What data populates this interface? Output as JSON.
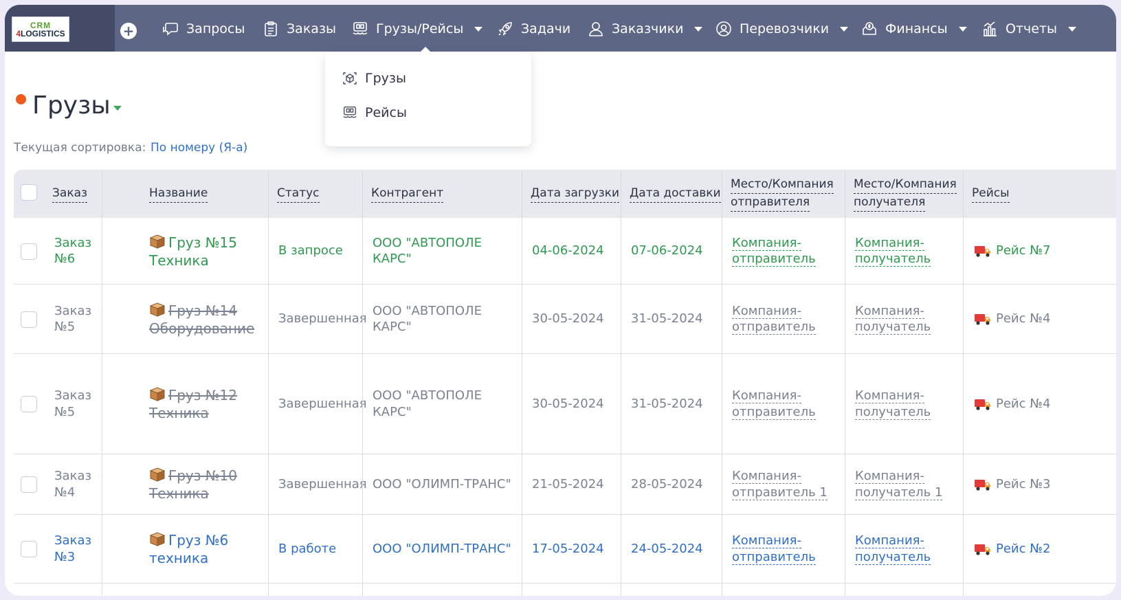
{
  "app": {
    "logo_top": "CRM",
    "logo_bottom_prefix": "4",
    "logo_bottom_rest": "LOGISTICS"
  },
  "nav": {
    "add_symbol": "+",
    "items": [
      {
        "label": "Запросы",
        "icon": "chat-icon",
        "dropdown": false
      },
      {
        "label": "Заказы",
        "icon": "clipboard-icon",
        "dropdown": false
      },
      {
        "label": "Грузы/Рейсы",
        "icon": "cargo-ship-icon",
        "dropdown": true
      },
      {
        "label": "Задачи",
        "icon": "rocket-icon",
        "dropdown": false
      },
      {
        "label": "Заказчики",
        "icon": "user-icon",
        "dropdown": true
      },
      {
        "label": "Перевозчики",
        "icon": "user-circle-icon",
        "dropdown": true
      },
      {
        "label": "Финансы",
        "icon": "money-icon",
        "dropdown": true
      },
      {
        "label": "Отчеты",
        "icon": "chart-icon",
        "dropdown": true
      }
    ]
  },
  "dropdown": {
    "items": [
      {
        "label": "Грузы",
        "icon": "box-scan-icon"
      },
      {
        "label": "Рейсы",
        "icon": "cargo-ship-icon"
      }
    ]
  },
  "page": {
    "title": "Грузы",
    "sort_label": "Текущая сортировка:",
    "sort_value": "По номеру (Я-а)"
  },
  "colors": {
    "nav_bg": "#5d6685",
    "accent_dot": "#f05a1a",
    "active_green": "#2f9a4f",
    "in_work_blue": "#2f6fc5",
    "completed_grey": "#7a8190"
  },
  "table": {
    "headers": {
      "order": "Заказ",
      "name": "Название",
      "status": "Статус",
      "contractor": "Контрагент",
      "load_date": "Дата загрузки",
      "delivery_date": "Дата доставки",
      "sender_l1": "Место/Компания",
      "sender_l2": "отправителя",
      "receiver_l1": "Место/Компания",
      "receiver_l2": "получателя",
      "trips": "Рейсы"
    },
    "rows": [
      {
        "order_l1": "Заказ",
        "order_l2": "№6",
        "name_l1": "Груз №15",
        "name_l2": "Техника",
        "status": "В запросе",
        "contractor_l1": "ООО \"АВТОПОЛЕ",
        "contractor_l2": "КАРС\"",
        "load_date": "04-06-2024",
        "delivery_date": "07-06-2024",
        "sender_l1": "Компания-",
        "sender_l2": "отправитель",
        "receiver_l1": "Компания-",
        "receiver_l2": "получатель",
        "trip": "Рейс №7",
        "state": "request"
      },
      {
        "order_l1": "Заказ",
        "order_l2": "№5",
        "name_l1": "Груз №14",
        "name_l2": "Оборудование",
        "status": "Завершенная",
        "contractor_l1": "ООО \"АВТОПОЛЕ",
        "contractor_l2": "КАРС\"",
        "load_date": "30-05-2024",
        "delivery_date": "31-05-2024",
        "sender_l1": "Компания-",
        "sender_l2": "отправитель",
        "receiver_l1": "Компания-",
        "receiver_l2": "получатель",
        "trip": "Рейс №4",
        "state": "done"
      },
      {
        "order_l1": "Заказ",
        "order_l2": "№5",
        "name_l1": "Груз №12",
        "name_l2": "Техника",
        "status": "Завершенная",
        "contractor_l1": "ООО \"АВТОПОЛЕ",
        "contractor_l2": "КАРС\"",
        "load_date": "30-05-2024",
        "delivery_date": "31-05-2024",
        "sender_l1": "Компания-",
        "sender_l2": "отправитель",
        "receiver_l1": "Компания-",
        "receiver_l2": "получатель",
        "trip": "Рейс №4",
        "state": "done"
      },
      {
        "order_l1": "Заказ",
        "order_l2": "№4",
        "name_l1": "Груз №10",
        "name_l2": "Техника",
        "status": "Завершенная",
        "contractor_l1": "ООО \"ОЛИМП-ТРАНС\"",
        "contractor_l2": "",
        "load_date": "21-05-2024",
        "delivery_date": "28-05-2024",
        "sender_l1": "Компания-",
        "sender_l2": "отправитель 1",
        "receiver_l1": "Компания-",
        "receiver_l2": "получатель 1",
        "trip": "Рейс №3",
        "state": "done"
      },
      {
        "order_l1": "Заказ",
        "order_l2": "№3",
        "name_l1": "Груз №6",
        "name_l2": "техника",
        "status": "В работе",
        "contractor_l1": "ООО \"ОЛИМП-ТРАНС\"",
        "contractor_l2": "",
        "load_date": "17-05-2024",
        "delivery_date": "24-05-2024",
        "sender_l1": "Компания-",
        "sender_l2": "отправитель",
        "receiver_l1": "Компания-",
        "receiver_l2": "получатель",
        "trip": "Рейс №2",
        "state": "work"
      }
    ]
  }
}
